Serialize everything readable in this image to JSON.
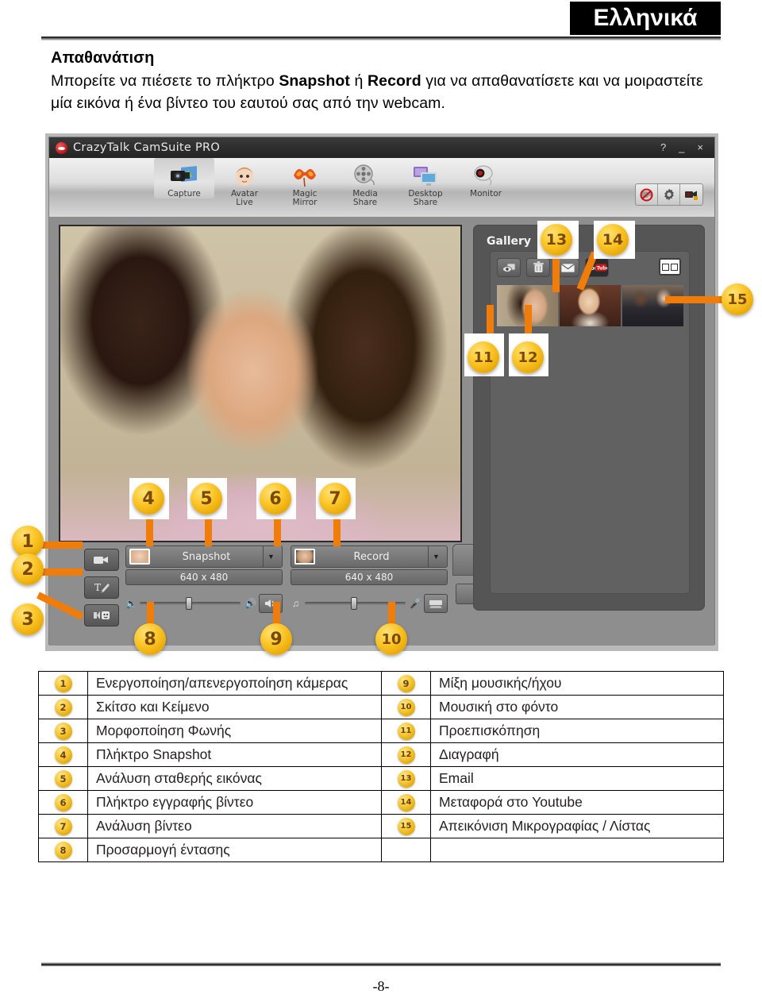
{
  "header": {
    "language_tab": "Ελληνικά"
  },
  "intro": {
    "heading": "Απαθανάτιση",
    "line1_part1": "Μπορείτε να πιέσετε το πλήκτρο ",
    "line1_bold1": "Snapshot",
    "line1_part2": " ή ",
    "line1_bold2": "Record",
    "line1_part3": " για να απαθανατίσετε",
    "line2": "και να μοιραστείτε μία εικόνα ή ένα βίντεο του εαυτού σας από την webcam."
  },
  "app": {
    "title": "CrazyTalk CamSuite PRO",
    "titlebar_buttons": [
      "?",
      "_",
      "×"
    ],
    "toolbar": [
      {
        "label_line1": "Capture",
        "label_line2": "",
        "icon": "camcorder-photo-icon",
        "active": true
      },
      {
        "label_line1": "Avatar",
        "label_line2": "Live",
        "icon": "baby-face-icon",
        "active": false
      },
      {
        "label_line1": "Magic",
        "label_line2": "Mirror",
        "icon": "carnival-mask-icon",
        "active": false
      },
      {
        "label_line1": "Media",
        "label_line2": "Share",
        "icon": "film-reel-icon",
        "active": false
      },
      {
        "label_line1": "Desktop",
        "label_line2": "Share",
        "icon": "monitor-share-icon",
        "active": false
      },
      {
        "label_line1": "Monitor",
        "label_line2": "",
        "icon": "webcam-icon",
        "active": false
      }
    ],
    "toolbar_right_icons": [
      "no-camera-icon",
      "gear-icon",
      "camera-lock-icon"
    ],
    "capture": {
      "snapshot_label": "Snapshot",
      "snapshot_resolution": "640 x 480",
      "record_label": "Record",
      "record_resolution": "640 x 480"
    },
    "gallery": {
      "title": "Gallery",
      "tools": [
        "preview-icon",
        "trash-icon",
        "email-icon",
        "youtube-icon"
      ],
      "view_toggle": "thumbnail-list-view-icon",
      "thumbnails": [
        "gallery-thumb-1",
        "gallery-thumb-2",
        "gallery-thumb-3"
      ]
    }
  },
  "callouts": [
    {
      "n": "1"
    },
    {
      "n": "2"
    },
    {
      "n": "3"
    },
    {
      "n": "4"
    },
    {
      "n": "5"
    },
    {
      "n": "6"
    },
    {
      "n": "7"
    },
    {
      "n": "8"
    },
    {
      "n": "9"
    },
    {
      "n": "10"
    },
    {
      "n": "11"
    },
    {
      "n": "12"
    },
    {
      "n": "13"
    },
    {
      "n": "14"
    },
    {
      "n": "15"
    }
  ],
  "legend": {
    "left": [
      {
        "num": "1",
        "text": "Ενεργοποίηση/απενεργοποίηση κάμερας"
      },
      {
        "num": "2",
        "text": "Σκίτσο και Κείμενο"
      },
      {
        "num": "3",
        "text": "Μορφοποίηση Φωνής"
      },
      {
        "num": "4",
        "text": "Πλήκτρο Snapshot"
      },
      {
        "num": "5",
        "text": "Ανάλυση σταθερής εικόνας"
      },
      {
        "num": "6",
        "text": "Πλήκτρο εγγραφής βίντεο"
      },
      {
        "num": "7",
        "text": "Ανάλυση βίντεο"
      },
      {
        "num": "8",
        "text": "Προσαρμογή έντασης"
      }
    ],
    "right": [
      {
        "num": "9",
        "text": "Μίξη μουσικής/ήχου"
      },
      {
        "num": "10",
        "text": "Μουσική στο φόντο"
      },
      {
        "num": "11",
        "text": "Προεπισκόπηση"
      },
      {
        "num": "12",
        "text": "Διαγραφή"
      },
      {
        "num": "13",
        "text": "Email"
      },
      {
        "num": "14",
        "text": "Μεταφορά στο Youtube"
      },
      {
        "num": "15",
        "text": "Απεικόνιση Μικρογραφίας / Λίστας"
      },
      {
        "num": "",
        "text": ""
      }
    ]
  },
  "footer": {
    "page_number": "-8-"
  },
  "colors": {
    "callout": "#f5c430",
    "leader_line": "#f07d0a",
    "app_chrome": "#8e8e8e",
    "titlebar": "#2d2d2d"
  }
}
